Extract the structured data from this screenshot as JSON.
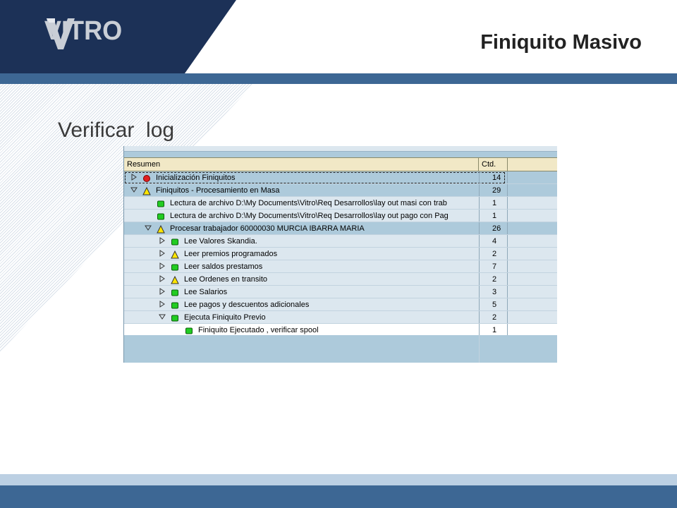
{
  "header": {
    "logo_text": "VITRO",
    "title": "Finiquito Masivo",
    "subtitle": "Verificar  log",
    "navy": "#1c3157",
    "stripe": "#3d6794"
  },
  "sap_tree": {
    "columns": {
      "summary": "Resumen",
      "count": "Ctd."
    },
    "rows": [
      {
        "level": 0,
        "expander": "collapsed",
        "status": "red",
        "text": "Inicialización Finiquitos",
        "count": "14"
      },
      {
        "level": 0,
        "expander": "expanded",
        "status": "yellow",
        "text": "Finiquitos - Procesamiento en Masa",
        "count": "29"
      },
      {
        "level": 1,
        "expander": "none",
        "status": "green",
        "text": "Lectura de archivo D:\\My Documents\\Vitro\\Req Desarrollos\\lay out masi con trab",
        "count": "1"
      },
      {
        "level": 1,
        "expander": "none",
        "status": "green",
        "text": "Lectura de archivo D:\\My Documents\\Vitro\\Req Desarrollos\\lay out pago con Pag",
        "count": "1"
      },
      {
        "level": 1,
        "expander": "expanded",
        "status": "yellow",
        "text": "Procesar trabajador 60000030 MURCIA IBARRA MARIA",
        "count": "26"
      },
      {
        "level": 2,
        "expander": "collapsed",
        "status": "green",
        "text": "Lee Valores Skandia.",
        "count": "4"
      },
      {
        "level": 2,
        "expander": "collapsed",
        "status": "yellow",
        "text": "Leer premios programados",
        "count": "2"
      },
      {
        "level": 2,
        "expander": "collapsed",
        "status": "green",
        "text": "Leer saldos prestamos",
        "count": "7"
      },
      {
        "level": 2,
        "expander": "collapsed",
        "status": "yellow",
        "text": "Lee Ordenes en transito",
        "count": "2"
      },
      {
        "level": 2,
        "expander": "collapsed",
        "status": "green",
        "text": "Lee Salarios",
        "count": "3"
      },
      {
        "level": 2,
        "expander": "collapsed",
        "status": "green",
        "text": "Lee pagos y descuentos adicionales",
        "count": "5"
      },
      {
        "level": 2,
        "expander": "expanded",
        "status": "green",
        "text": "Ejecuta Finiquito Previo",
        "count": "2"
      },
      {
        "level": 3,
        "expander": "none",
        "status": "green",
        "text": "Finiquito Ejecutado , verificar spool",
        "count": "1"
      }
    ]
  },
  "icons": {
    "expander_collapsed": "triangle-right-icon",
    "expander_expanded": "triangle-down-icon",
    "status_red": "red-circle-icon",
    "status_yellow": "yellow-triangle-icon",
    "status_green": "green-square-icon"
  },
  "colors": {
    "red": "#e02020",
    "yellow": "#ffe600",
    "green": "#22cc22"
  }
}
